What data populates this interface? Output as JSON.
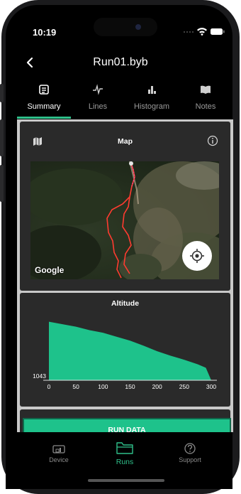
{
  "status": {
    "time": "10:19"
  },
  "header": {
    "title": "Run01.byb"
  },
  "tabs": [
    {
      "label": "Summary",
      "icon": "list-icon",
      "active": true
    },
    {
      "label": "Lines",
      "icon": "pulse-icon",
      "active": false
    },
    {
      "label": "Histogram",
      "icon": "bar-chart-icon",
      "active": false
    },
    {
      "label": "Notes",
      "icon": "book-icon",
      "active": false
    }
  ],
  "map_card": {
    "title": "Map",
    "attribution": "Google"
  },
  "altitude_card": {
    "title": "Altitude",
    "chart_data": {
      "type": "area",
      "title": "Altitude",
      "x": [
        0,
        10,
        25,
        50,
        75,
        100,
        125,
        150,
        175,
        200,
        225,
        250,
        275,
        290,
        300
      ],
      "y": [
        1160,
        1158,
        1155,
        1150,
        1143,
        1138,
        1130,
        1122,
        1112,
        1101,
        1092,
        1084,
        1075,
        1068,
        1043
      ],
      "x_ticks": [
        "0",
        "50",
        "100",
        "150",
        "200",
        "250",
        "300"
      ],
      "y_tick_label": "1043",
      "xlim": [
        0,
        300
      ],
      "ylim": [
        1043,
        1175
      ],
      "color": "#1ec28b"
    }
  },
  "run_data_button": {
    "label": "RUN DATA"
  },
  "bottom_nav": [
    {
      "label": "Device",
      "icon": "device-icon",
      "active": false
    },
    {
      "label": "Runs",
      "icon": "folder-icon",
      "active": true
    },
    {
      "label": "Support",
      "icon": "help-icon",
      "active": false
    }
  ],
  "colors": {
    "accent": "#1ec28b",
    "track": "#ff3b30"
  }
}
